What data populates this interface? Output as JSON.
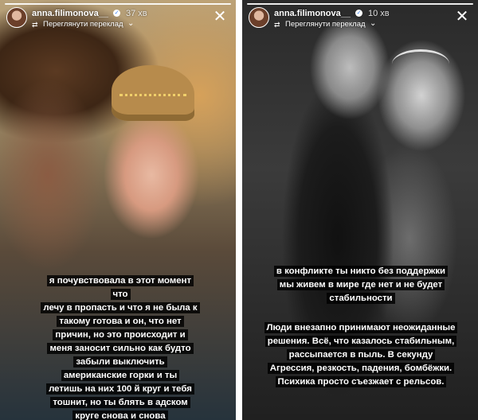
{
  "stories": [
    {
      "username": "anna.filimonova__",
      "time": "37 хв",
      "repost_label": "Переглянути переклад",
      "overlay_lines": [
        "я почувствовала в этот момент",
        "что",
        "лечу в пропасть и что я не была к",
        "такому готова и он, что нет",
        "причин, но это происходит и",
        "меня заносит сильно как будто",
        "забыли выключить",
        "американские горки и ты",
        "летишь на них 100 й круг и тебя",
        "тошнит, но ты блять в адском",
        "круге снова и снова"
      ]
    },
    {
      "username": "anna.filimonova__",
      "time": "10 хв",
      "repost_label": "Переглянути переклад",
      "overlay_top_lines": [
        "в конфликте ты никто без поддержки",
        "мы живем  в мире где нет и не будет",
        "стабильности"
      ],
      "overlay_bottom_lines": [
        "Люди внезапно принимают неожиданные",
        "решения. Всё, что казалось стабильным,",
        "рассыпается в пыль. В секунду",
        "Агрессия, резкость, падения, бомбёжки.",
        "Психика просто съезжает с рельсов."
      ]
    }
  ],
  "icons": {
    "verified": "verified-badge-icon",
    "repost": "repost-icon",
    "chevron": "chevron-down-icon",
    "close": "close-icon"
  }
}
